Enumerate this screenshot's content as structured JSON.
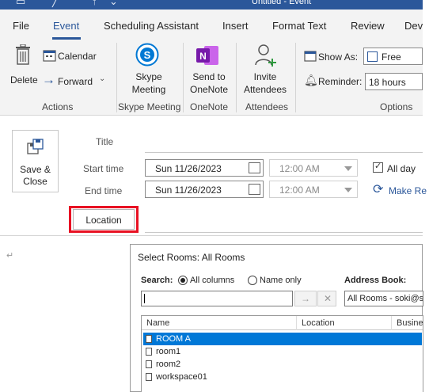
{
  "window": {
    "title": "Untitled  -  Event"
  },
  "tabs": [
    "File",
    "Event",
    "Scheduling Assistant",
    "Insert",
    "Format Text",
    "Review",
    "Dev"
  ],
  "ribbon": {
    "delete": "Delete",
    "calendar": "Calendar",
    "forward": "Forward",
    "actions_group": "Actions",
    "skype_line1": "Skype",
    "skype_line2": "Meeting",
    "skype_group": "Skype Meeting",
    "onenote_line1": "Send to",
    "onenote_line2": "OneNote",
    "onenote_group": "OneNote",
    "invite_line1": "Invite",
    "invite_line2": "Attendees",
    "attendees_group": "Attendees",
    "show_as_label": "Show As:",
    "show_as_value": "Free",
    "reminder_label": "Reminder:",
    "reminder_value": "18 hours",
    "options_group": "Options"
  },
  "form": {
    "save_line1": "Save &",
    "save_line2": "Close",
    "title_label": "Title",
    "start_label": "Start time",
    "end_label": "End time",
    "start_date": "Sun 11/26/2023",
    "end_date": "Sun 11/26/2023",
    "start_time": "12:00 AM",
    "end_time": "12:00 AM",
    "all_day": "All day",
    "make_recurring": "Make Re",
    "location": "Location"
  },
  "dialog": {
    "title": "Select Rooms: All Rooms",
    "search_label": "Search:",
    "opt_all_columns": "All columns",
    "opt_name_only": "Name only",
    "address_book_label": "Address Book:",
    "address_book_value": "All Rooms - soki@s",
    "search_value": "",
    "columns": [
      "Name",
      "Location",
      "Busine"
    ],
    "rows": [
      "ROOM A",
      "room1",
      "room2",
      "workspace01"
    ]
  },
  "colors": {
    "accent": "#2b579a",
    "highlight": "#e81123",
    "selection": "#0078d7"
  }
}
